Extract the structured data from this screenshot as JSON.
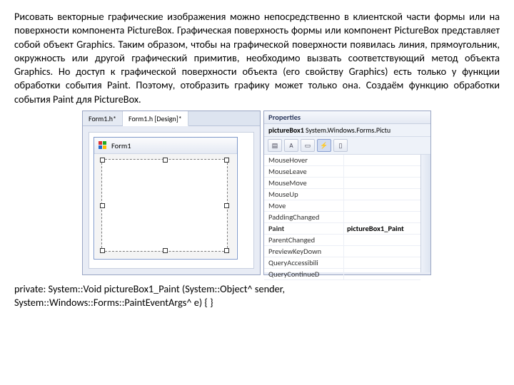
{
  "paragraph": "Рисовать векторные графические изображения можно непосредственно в клиентской части формы или на поверхности компонента PictureBox. Графическая поверхность формы или компонент PictureBox представляет собой объект Graphics. Таким образом, чтобы на графической поверхности появилась  линия, прямоугольник, окружность или другой графический примитив, необходимо вызвать соответствующий метод объекта Graphics. Но доступ к графической поверхности объекта (его свойству Graphics) есть только у функции обработки события Paint. Поэтому, отобразить графику может только она. Создаём функцию обработки события Paint для PictureBox.",
  "tabs": {
    "t1": "Form1.h*",
    "t2": "Form1.h [Design]*"
  },
  "formTitle": "Form1",
  "propPanel": {
    "title": "Properties",
    "sub1": "pictureBox1",
    "sub2": " System.Windows.Forms.Pictu"
  },
  "events": [
    {
      "name": "MouseHover",
      "val": ""
    },
    {
      "name": "MouseLeave",
      "val": ""
    },
    {
      "name": "MouseMove",
      "val": ""
    },
    {
      "name": "MouseUp",
      "val": ""
    },
    {
      "name": "Move",
      "val": ""
    },
    {
      "name": "PaddingChanged",
      "val": ""
    },
    {
      "name": "Paint",
      "val": "pictureBox1_Paint"
    },
    {
      "name": "ParentChanged",
      "val": ""
    },
    {
      "name": "PreviewKeyDown",
      "val": ""
    },
    {
      "name": "QueryAccessibili",
      "val": ""
    },
    {
      "name": "QueryContinueD",
      "val": ""
    }
  ],
  "code1": "private: System::Void pictureBox1_Paint (System::Object^  sender,",
  "code2": "System::Windows::Forms::PaintEventArgs^  e) {     }"
}
